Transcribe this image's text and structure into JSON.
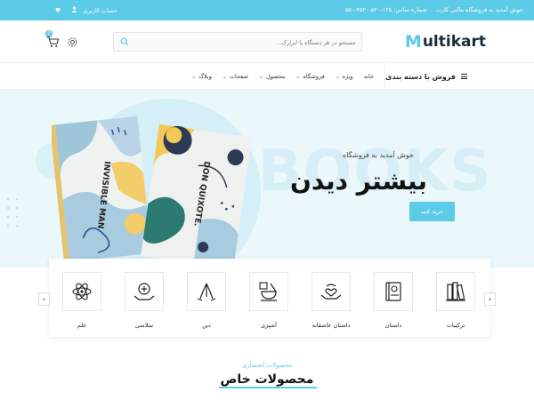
{
  "topbar": {
    "welcome": "خوش آمدید به فروشگاه مالتی کارت",
    "phone": "شماره تماس: ۱۲۵-۵۲۰-۴۵۲۰-۵۵۰",
    "account": "حساب کاربری"
  },
  "header": {
    "logo_m": "M",
    "logo_rest": "ultikart",
    "search_placeholder": "جستجو در هر دستگاه یا ابزارک...",
    "cart_count": "0"
  },
  "nav": {
    "category_button": "فروش با دسته بندی",
    "menu": [
      {
        "label": "خانه",
        "has_dropdown": false
      },
      {
        "label": "ویژه",
        "has_dropdown": true
      },
      {
        "label": "فروشگاه",
        "has_dropdown": true
      },
      {
        "label": "محصول",
        "has_dropdown": true
      },
      {
        "label": "صفحات",
        "has_dropdown": true
      },
      {
        "label": "وبلاگ",
        "has_dropdown": true
      }
    ]
  },
  "hero": {
    "welcome": "خوش آمدید به فروشگاه",
    "heading": "بیشتر دیدن",
    "background_word": "BOOKS",
    "button": "خرید کنید",
    "book1_title": "INVISIBLE MAN",
    "book2_title": "DON QUIXOTE."
  },
  "categories": [
    {
      "label": "ترکیبات",
      "icon": "books-icon"
    },
    {
      "label": "داستان",
      "icon": "book-icon"
    },
    {
      "label": "داستان عاشقانه",
      "icon": "heart-hand-icon"
    },
    {
      "label": "آشپزی",
      "icon": "cooking-icon"
    },
    {
      "label": "دین",
      "icon": "praying-hands-icon"
    },
    {
      "label": "سلامتی",
      "icon": "health-icon"
    },
    {
      "label": "علم",
      "icon": "atom-icon"
    }
  ],
  "section": {
    "subtitle": "محصولات انحصاری",
    "title": "محصولات خاص"
  },
  "colors": {
    "accent": "#5ccbe8",
    "hero_bg": "#eaf7fb"
  }
}
